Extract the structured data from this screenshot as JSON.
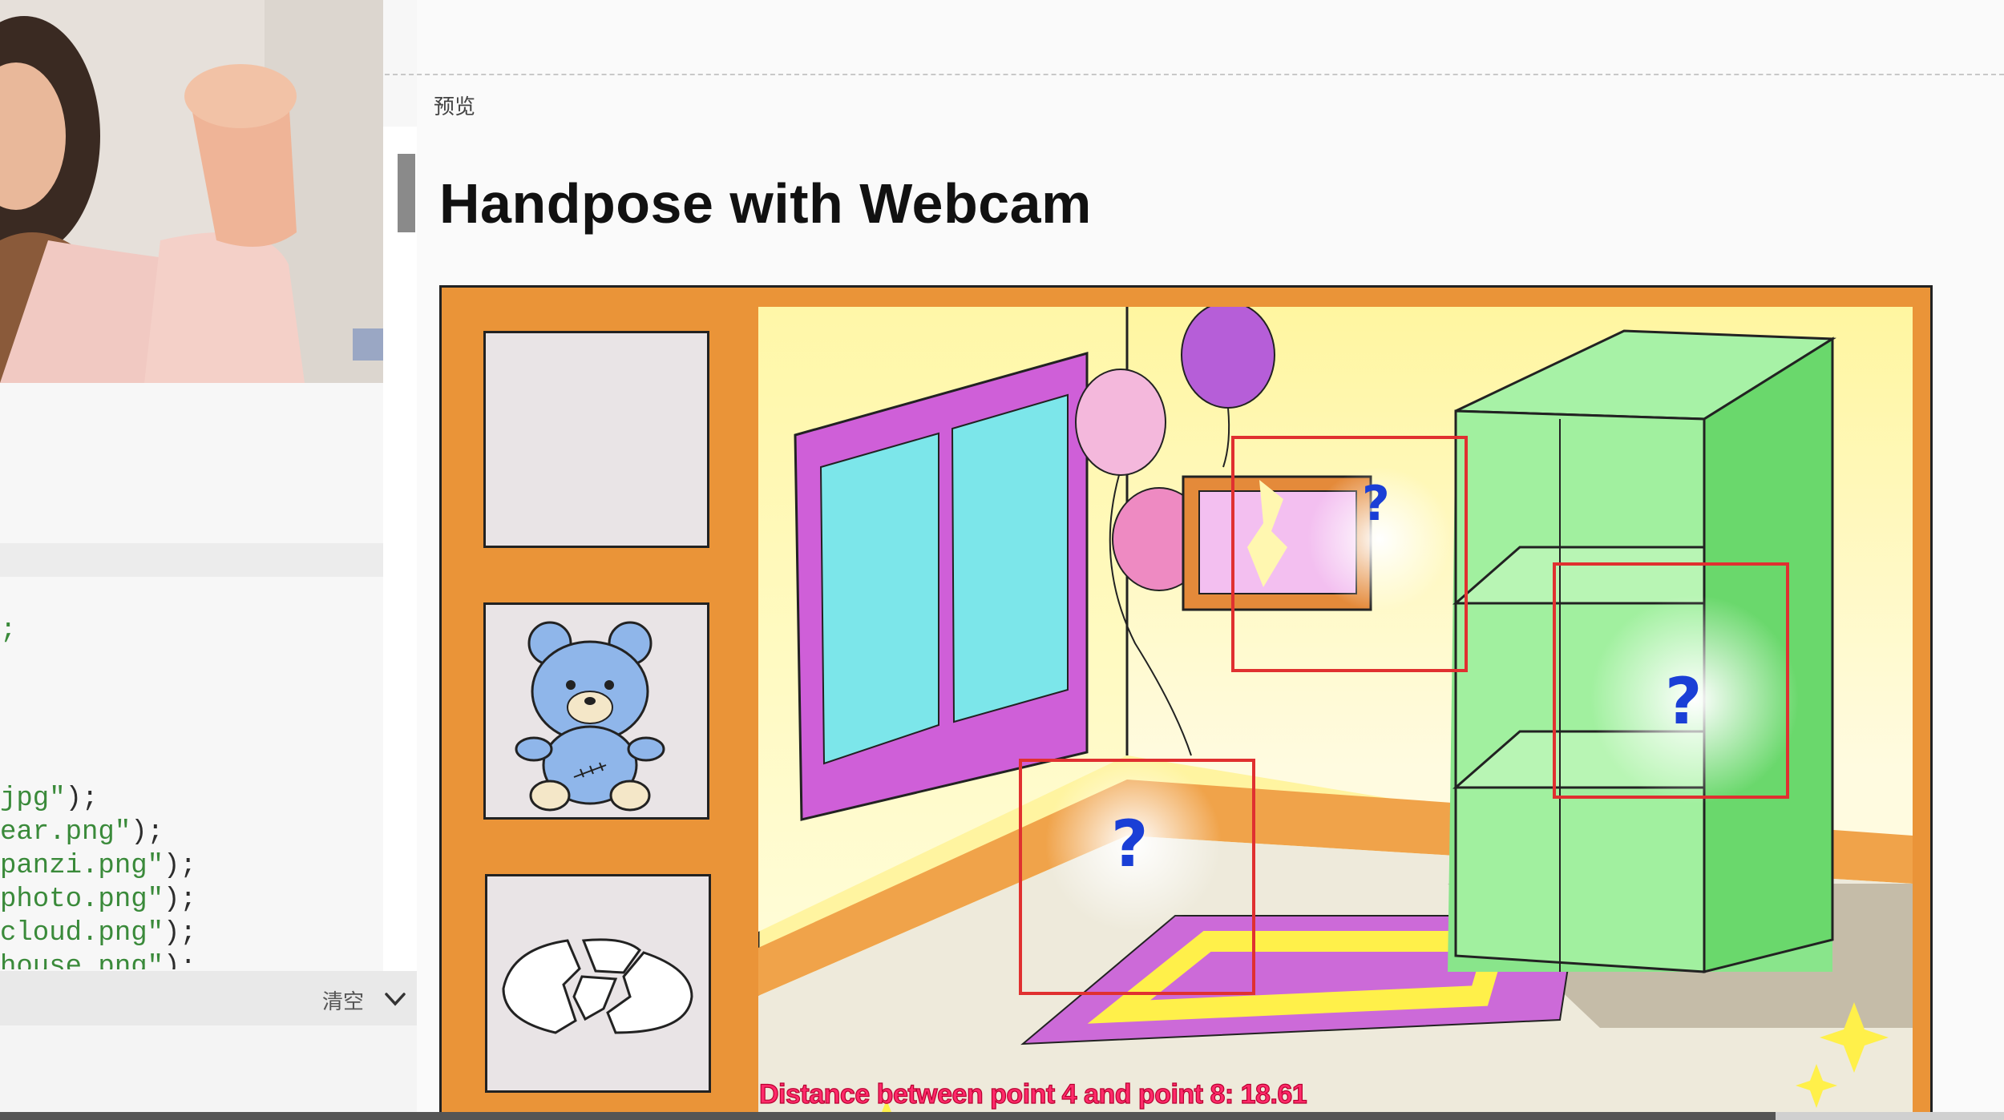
{
  "editor": {
    "code_lines": [
      {
        "pre": "",
        "str": ";",
        "post": ""
      },
      {
        "pre": "",
        "str": "jpg\"",
        "post": ");"
      },
      {
        "pre": "",
        "str": "ear.png\"",
        "post": ");"
      },
      {
        "pre": "",
        "str": "panzi.png\"",
        "post": ");"
      },
      {
        "pre": "",
        "str": "photo.png\"",
        "post": ");"
      },
      {
        "pre": "",
        "str": "cloud.png\"",
        "post": ");"
      },
      {
        "pre": "",
        "str": "house.png\"",
        "post": ");"
      }
    ],
    "console_clear_label": "清空"
  },
  "preview": {
    "label": "预览",
    "title": "Handpose with Webcam"
  },
  "game": {
    "distance_text": "Distance between point 4 and point 8: 18.61",
    "hint_marks": [
      "?",
      "?",
      "?"
    ],
    "inventory_slots": [
      "empty-slot",
      "teddy-bear",
      "broken-plate"
    ]
  },
  "colors": {
    "frame_orange": "#ea9438",
    "hint_box_red": "#e03030",
    "question_blue": "#1a3fd6",
    "distance_text": "#ff2a6a"
  },
  "icons": {
    "collapse": "chevron-down-icon"
  }
}
